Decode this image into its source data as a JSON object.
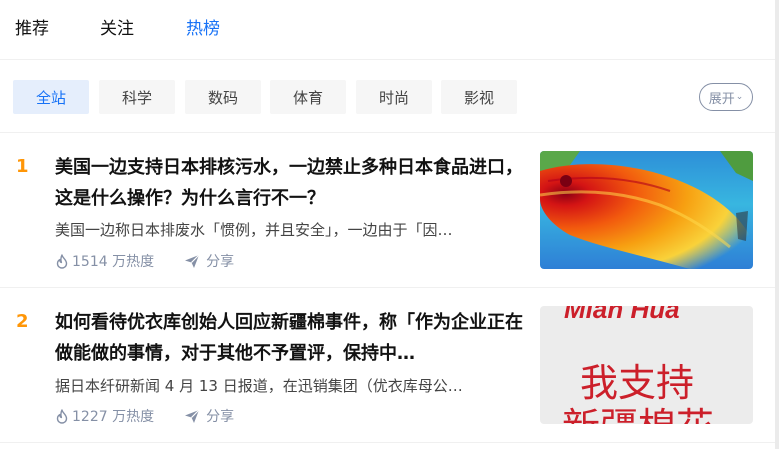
{
  "top_tabs": [
    {
      "label": "推荐"
    },
    {
      "label": "关注"
    },
    {
      "label": "热榜"
    }
  ],
  "active_tab": "热榜",
  "filters": [
    {
      "label": "全站"
    },
    {
      "label": "科学"
    },
    {
      "label": "数码"
    },
    {
      "label": "体育"
    },
    {
      "label": "时尚"
    },
    {
      "label": "影视"
    }
  ],
  "active_filter": "全站",
  "expand_label": "展开",
  "hot_items": [
    {
      "rank": "1",
      "title": "美国一边支持日本排核污水，一边禁止多种日本食品进口，这是什么操作？为什么言行不一？",
      "excerpt": "美国一边称日本排废水「惯例，并且安全」，一边由于「因…",
      "heat": "1514 万热度",
      "share": "分享",
      "thumbnail": "ocean-radiation-map"
    },
    {
      "rank": "2",
      "title": "如何看待优衣库创始人回应新疆棉事件，称「作为企业正在做能做的事情，对于其他不予置评，保持中…",
      "excerpt": "据日本纤研新闻 4 月 13 日报道，在迅销集团（优衣库母公…",
      "heat": "1227 万热度",
      "share": "分享",
      "thumbnail": "xinjiang-cotton-sign",
      "thumbnail_text": {
        "top": "Mian Hua",
        "middle": "我支持",
        "bottom": "新疆棉花"
      }
    }
  ],
  "colors": {
    "accent": "#1772f6",
    "rank": "#ff9607",
    "meta": "#8590a6"
  }
}
